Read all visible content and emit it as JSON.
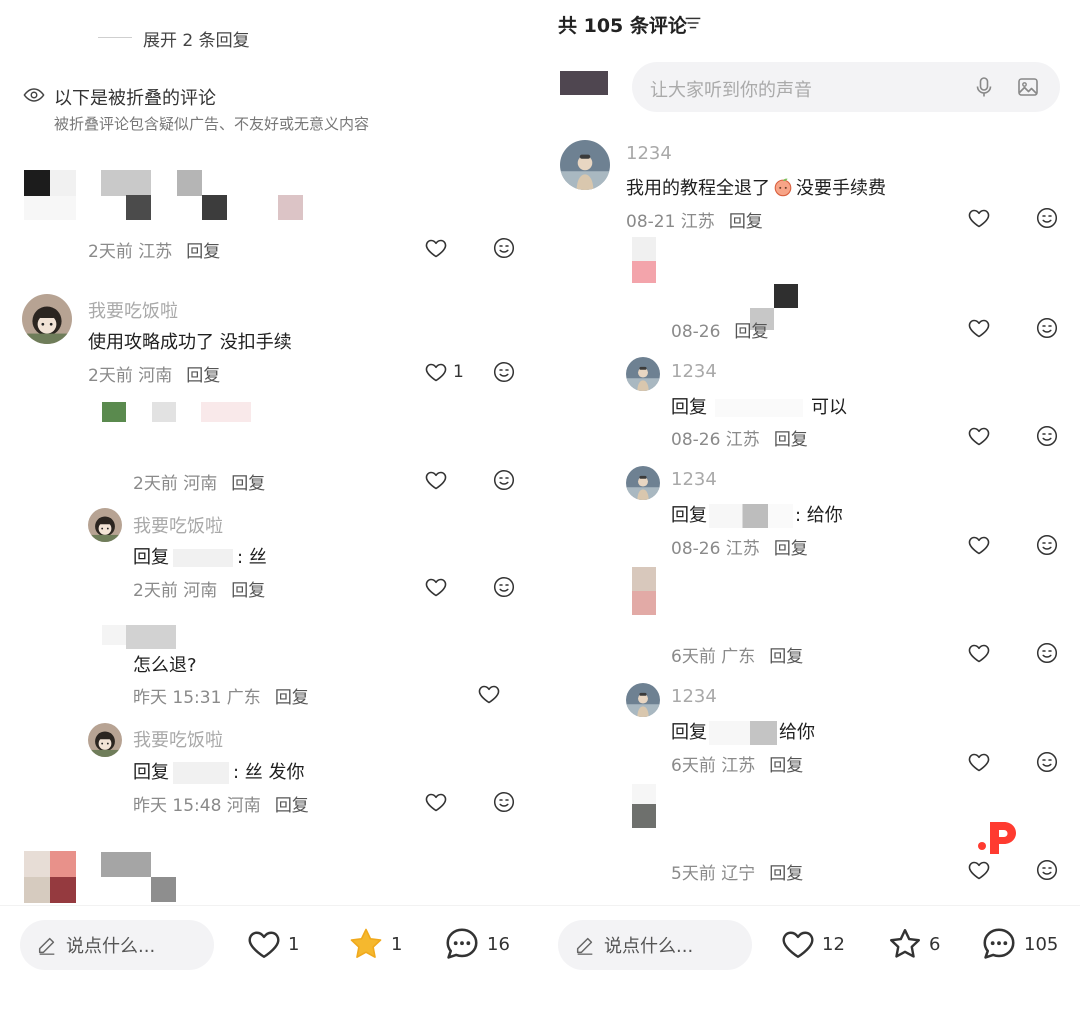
{
  "left": {
    "expand_replies": "展开 2 条回复",
    "folded_title": "以下是被折叠的评论",
    "folded_desc": "被折叠评论包含疑似广告、不友好或无意义内容",
    "c1": {
      "meta": "2天前 江苏",
      "reply": "回复"
    },
    "c2": {
      "name": "我要吃饭啦",
      "text": "使用攻略成功了 没扣手续",
      "meta": "2天前 河南",
      "reply": "回复",
      "likes": "1"
    },
    "c3": {
      "meta": "2天前 河南",
      "reply": "回复"
    },
    "c4": {
      "name": "我要吃饭啦",
      "reply_prefix": "回复",
      "text": ": 丝",
      "meta": "2天前 河南",
      "reply": "回复"
    },
    "c5": {
      "text": "怎么退?",
      "meta": "昨天 15:31 广东",
      "reply": "回复"
    },
    "c6": {
      "name": "我要吃饭啦",
      "reply_prefix": "回复",
      "text": ": 丝 发你",
      "meta": "昨天 15:48 河南",
      "reply": "回复"
    },
    "bottom": {
      "say": "说点什么...",
      "likes": "1",
      "stars": "1",
      "comments": "16"
    }
  },
  "right": {
    "header": "共 105 条评论",
    "input_placeholder": "让大家听到你的声音",
    "r1": {
      "name": "1234",
      "text": "我用的教程全退了",
      "text2": "没要手续费",
      "meta": "08-21 江苏",
      "reply": "回复"
    },
    "r2": {
      "meta": "08-26",
      "reply": "回复"
    },
    "r3": {
      "name": "1234",
      "reply_prefix": "回复",
      "text": "可以",
      "meta": "08-26 江苏",
      "reply": "回复"
    },
    "r4": {
      "name": "1234",
      "reply_prefix": "回复",
      "text": ": 给你",
      "meta": "08-26 江苏",
      "reply": "回复"
    },
    "r5": {
      "meta": "6天前 广东",
      "reply": "回复"
    },
    "r6": {
      "name": "1234",
      "reply_prefix": "回复",
      "text": "给你",
      "meta": "6天前 江苏",
      "reply": "回复"
    },
    "r7": {
      "meta": "5天前 辽宁",
      "reply": "回复"
    },
    "bottom": {
      "say": "说点什么...",
      "likes": "12",
      "stars": "6",
      "comments": "105"
    }
  },
  "colors": {
    "star_active": "#f5b82e",
    "watermark": "#ff3b30",
    "accent_pink": "#f2a9ad"
  }
}
